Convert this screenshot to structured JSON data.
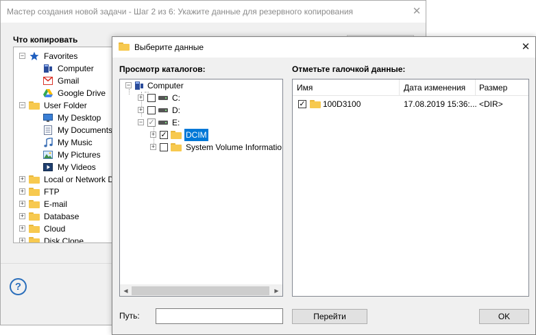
{
  "wizard": {
    "title": "Мастер создания новой задачи - Шаг 2 из 6: Укажите данные для резервного копирования",
    "section_label": "Что копировать",
    "close_glyph": "✕",
    "help_glyph": "?",
    "tree": [
      {
        "label": "Favorites",
        "icon": "star-icon",
        "level": 0,
        "expander": "−"
      },
      {
        "label": "Computer",
        "icon": "computer-icon",
        "level": 1,
        "expander": ""
      },
      {
        "label": "Gmail",
        "icon": "gmail-icon",
        "level": 1,
        "expander": ""
      },
      {
        "label": "Google Drive",
        "icon": "google-drive-icon",
        "level": 1,
        "expander": ""
      },
      {
        "label": "User Folder",
        "icon": "folder-icon",
        "level": 0,
        "expander": "−"
      },
      {
        "label": "My Desktop",
        "icon": "desktop-icon",
        "level": 1,
        "expander": ""
      },
      {
        "label": "My Documents",
        "icon": "documents-icon",
        "level": 1,
        "expander": ""
      },
      {
        "label": "My Music",
        "icon": "music-icon",
        "level": 1,
        "expander": ""
      },
      {
        "label": "My Pictures",
        "icon": "pictures-icon",
        "level": 1,
        "expander": ""
      },
      {
        "label": "My Videos",
        "icon": "videos-icon",
        "level": 1,
        "expander": ""
      },
      {
        "label": "Local or Network D",
        "icon": "folder-icon",
        "level": 0,
        "expander": "+"
      },
      {
        "label": "FTP",
        "icon": "folder-icon",
        "level": 0,
        "expander": "+"
      },
      {
        "label": "E-mail",
        "icon": "folder-icon",
        "level": 0,
        "expander": "+"
      },
      {
        "label": "Database",
        "icon": "folder-icon",
        "level": 0,
        "expander": "+"
      },
      {
        "label": "Cloud",
        "icon": "folder-icon",
        "level": 0,
        "expander": "+"
      },
      {
        "label": "Disk Clone",
        "icon": "folder-icon",
        "level": 0,
        "expander": "+"
      }
    ]
  },
  "dialog": {
    "title": "Выберите данные",
    "close_glyph": "✕",
    "browse_label": "Просмотр каталогов:",
    "check_label": "Отметьте галочкой данные:",
    "dir_tree": {
      "root": "Computer",
      "drives": [
        {
          "label": "C:",
          "checked": false
        },
        {
          "label": "D:",
          "checked": false
        },
        {
          "label": "E:",
          "checked": true
        }
      ],
      "folders": [
        {
          "label": "DCIM",
          "checked": true,
          "selected": true
        },
        {
          "label": "System Volume Informatio",
          "checked": false,
          "selected": false
        }
      ],
      "scroll_left": "◀",
      "scroll_right": "▶"
    },
    "file_list": {
      "columns": [
        "Имя",
        "Дата изменения",
        "Размер"
      ],
      "rows": [
        {
          "name": "100D3100",
          "modified": "17.08.2019 15:36:...",
          "size": "<DIR>",
          "checked": true
        }
      ]
    },
    "path_label": "Путь:",
    "path_value": "",
    "go_button": "Перейти",
    "ok_button": "OK"
  },
  "colors": {
    "selection": "#0078d7",
    "folder": "#f7c94f",
    "accent_blue": "#2a6ebb"
  }
}
